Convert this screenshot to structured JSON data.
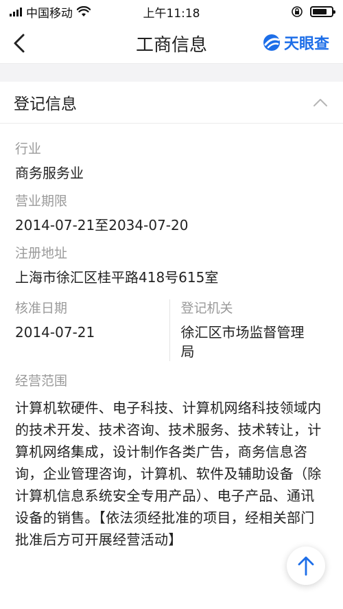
{
  "status_bar": {
    "carrier": "中国移动",
    "time": "上午11:18",
    "battery_level": 0.75
  },
  "nav": {
    "title": "工商信息",
    "brand": "天眼查",
    "brand_color": "#1d6ee8"
  },
  "section": {
    "title": "登记信息"
  },
  "fields": {
    "industry": {
      "label": "行业",
      "value": "商务服务业"
    },
    "term": {
      "label": "营业期限",
      "value": "2014-07-21至2034-07-20"
    },
    "address": {
      "label": "注册地址",
      "value": "上海市徐汇区桂平路418号615室"
    },
    "approval_date": {
      "label": "核准日期",
      "value": "2014-07-21"
    },
    "authority": {
      "label": "登记机关",
      "value": "徐汇区市场监督管理局"
    },
    "scope": {
      "label": "经营范围",
      "value": "计算机软硬件、电子科技、计算机网络科技领域内的技术开发、技术咨询、技术服务、技术转让，计算机网络集成，设计制作各类广告，商务信息咨询，企业管理咨询，计算机、软件及辅助设备（除计算机信息系统安全专用产品）、电子产品、通讯设备的销售。【依法须经批准的项目，经相关部门批准后方可开展经营活动】"
    }
  },
  "icons": {
    "back": "chevron-left-icon",
    "collapse": "chevron-up-icon",
    "back_to_top": "arrow-up-icon"
  }
}
